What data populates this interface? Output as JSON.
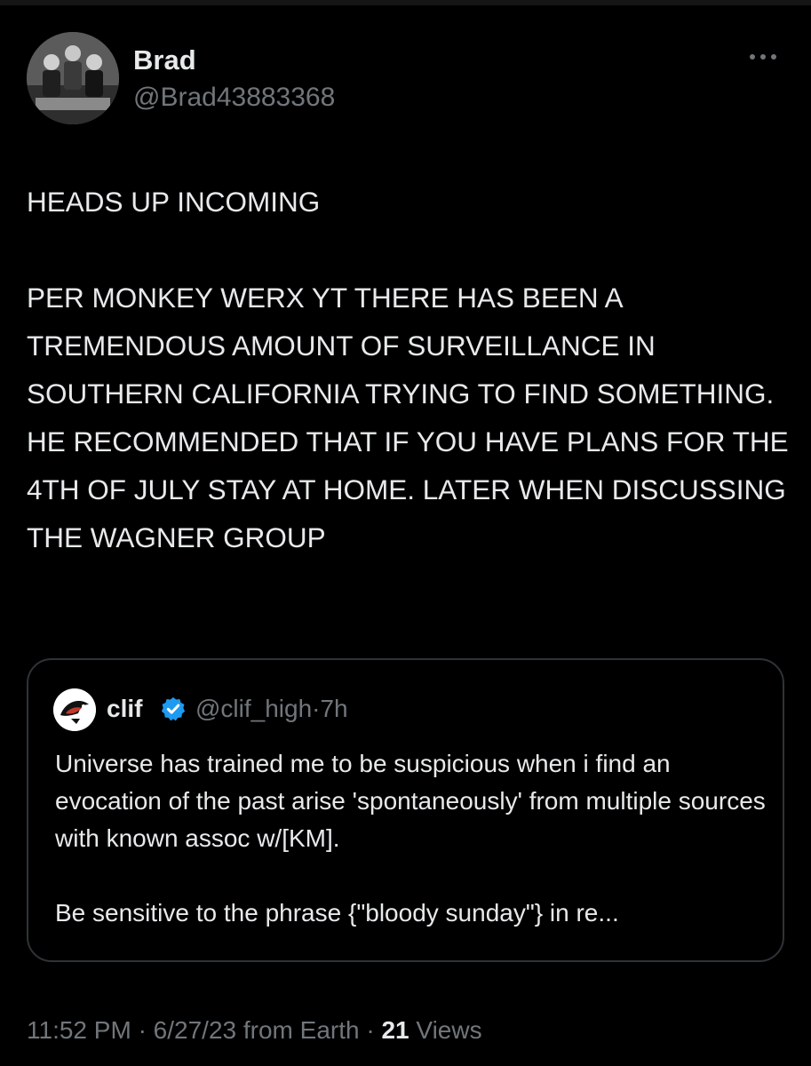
{
  "author": {
    "name": "Brad",
    "handle": "@Brad43883368",
    "avatar_icon": "profile-photo"
  },
  "more_icon": "more-horizontal-icon",
  "tweet": {
    "text": "HEADS UP INCOMING\n\nPER MONKEY WERX YT THERE HAS BEEN A TREMENDOUS AMOUNT OF SURVEILLANCE IN SOUTHERN CALIFORNIA TRYING TO FIND SOMETHING. HE RECOMMENDED THAT IF YOU HAVE PLANS FOR THE 4TH OF JULY STAY AT HOME. LATER WHEN DISCUSSING THE WAGNER GROUP"
  },
  "quote": {
    "name": "clif",
    "handle": "@clif_high",
    "separator": "·",
    "time": "7h",
    "verified": true,
    "text": "Universe has trained me to be suspicious when i find an evocation of the past arise 'spontaneously' from multiple sources with known assoc w/[KM].\n\nBe sensitive to the phrase {\"bloody sunday\"} in re..."
  },
  "footer": {
    "time": "11:52 PM",
    "sep1": "·",
    "date": "6/27/23",
    "source": "from Earth",
    "sep2": "·",
    "views_count": "21",
    "views_label": "Views"
  },
  "colors": {
    "background": "#000000",
    "text_primary": "#e7e9ea",
    "text_secondary": "#71767b",
    "border": "#2f3336",
    "verified_blue": "#1d9bf0"
  }
}
